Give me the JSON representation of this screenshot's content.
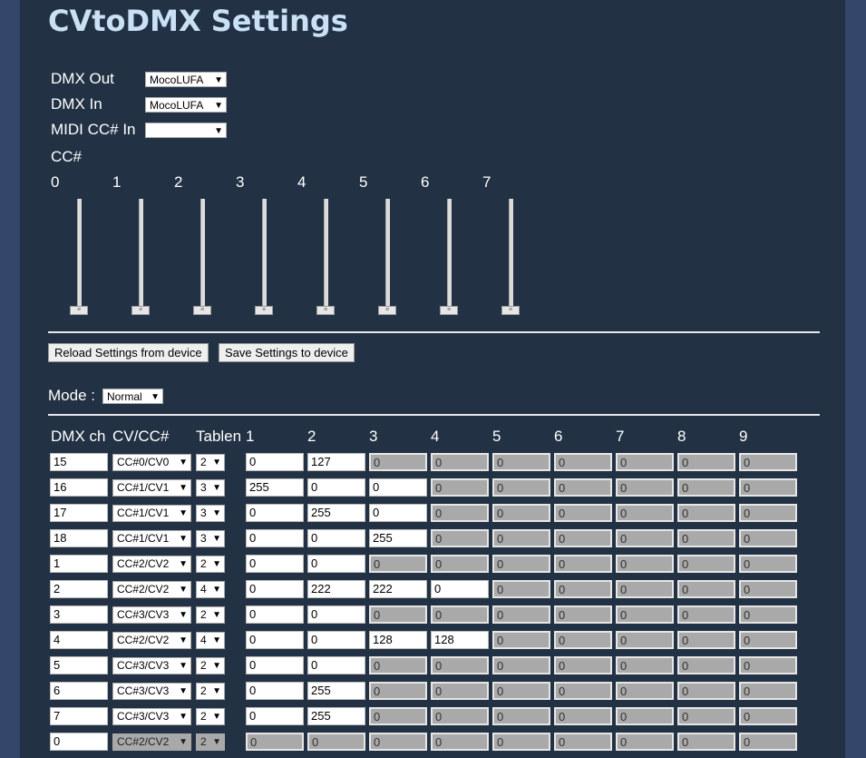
{
  "page_title": "CVtoDMX Settings",
  "dmx_out": {
    "label": "DMX Out",
    "value": "MocoLUFA"
  },
  "dmx_in": {
    "label": "DMX In",
    "value": "MocoLUFA"
  },
  "midi_cc_in": {
    "label": "MIDI CC# In",
    "value": ""
  },
  "cc_label": "CC#",
  "cc_numbers": [
    "0",
    "1",
    "2",
    "3",
    "4",
    "5",
    "6",
    "7"
  ],
  "cc_values": [
    0,
    0,
    0,
    0,
    0,
    0,
    0,
    0
  ],
  "reload_button": "Reload Settings from device",
  "save_button": "Save Settings to device",
  "mode": {
    "label": "Mode :",
    "value": "Normal"
  },
  "table": {
    "headers": [
      "DMX ch",
      "CV/CC#",
      "Tablen",
      "1",
      "2",
      "3",
      "4",
      "5",
      "6",
      "7",
      "8",
      "9"
    ],
    "rows": [
      {
        "ch": "15",
        "cv": "CC#0/CV0",
        "tablen": "2",
        "vals": [
          "0",
          "127",
          "0",
          "0",
          "0",
          "0",
          "0",
          "0",
          "0"
        ]
      },
      {
        "ch": "16",
        "cv": "CC#1/CV1",
        "tablen": "3",
        "vals": [
          "255",
          "0",
          "0",
          "0",
          "0",
          "0",
          "0",
          "0",
          "0"
        ]
      },
      {
        "ch": "17",
        "cv": "CC#1/CV1",
        "tablen": "3",
        "vals": [
          "0",
          "255",
          "0",
          "0",
          "0",
          "0",
          "0",
          "0",
          "0"
        ]
      },
      {
        "ch": "18",
        "cv": "CC#1/CV1",
        "tablen": "3",
        "vals": [
          "0",
          "0",
          "255",
          "0",
          "0",
          "0",
          "0",
          "0",
          "0"
        ]
      },
      {
        "ch": "1",
        "cv": "CC#2/CV2",
        "tablen": "2",
        "vals": [
          "0",
          "0",
          "0",
          "0",
          "0",
          "0",
          "0",
          "0",
          "0"
        ]
      },
      {
        "ch": "2",
        "cv": "CC#2/CV2",
        "tablen": "4",
        "vals": [
          "0",
          "222",
          "222",
          "0",
          "0",
          "0",
          "0",
          "0",
          "0"
        ]
      },
      {
        "ch": "3",
        "cv": "CC#3/CV3",
        "tablen": "2",
        "vals": [
          "0",
          "0",
          "0",
          "0",
          "0",
          "0",
          "0",
          "0",
          "0"
        ]
      },
      {
        "ch": "4",
        "cv": "CC#2/CV2",
        "tablen": "4",
        "vals": [
          "0",
          "0",
          "128",
          "128",
          "0",
          "0",
          "0",
          "0",
          "0"
        ]
      },
      {
        "ch": "5",
        "cv": "CC#3/CV3",
        "tablen": "2",
        "vals": [
          "0",
          "0",
          "0",
          "0",
          "0",
          "0",
          "0",
          "0",
          "0"
        ]
      },
      {
        "ch": "6",
        "cv": "CC#3/CV3",
        "tablen": "2",
        "vals": [
          "0",
          "255",
          "0",
          "0",
          "0",
          "0",
          "0",
          "0",
          "0"
        ]
      },
      {
        "ch": "7",
        "cv": "CC#3/CV3",
        "tablen": "2",
        "vals": [
          "0",
          "255",
          "0",
          "0",
          "0",
          "0",
          "0",
          "0",
          "0"
        ]
      },
      {
        "ch": "0",
        "cv": "CC#2/CV2",
        "tablen": "2",
        "vals": [
          "0",
          "0",
          "0",
          "0",
          "0",
          "0",
          "0",
          "0",
          "0"
        ]
      }
    ]
  }
}
